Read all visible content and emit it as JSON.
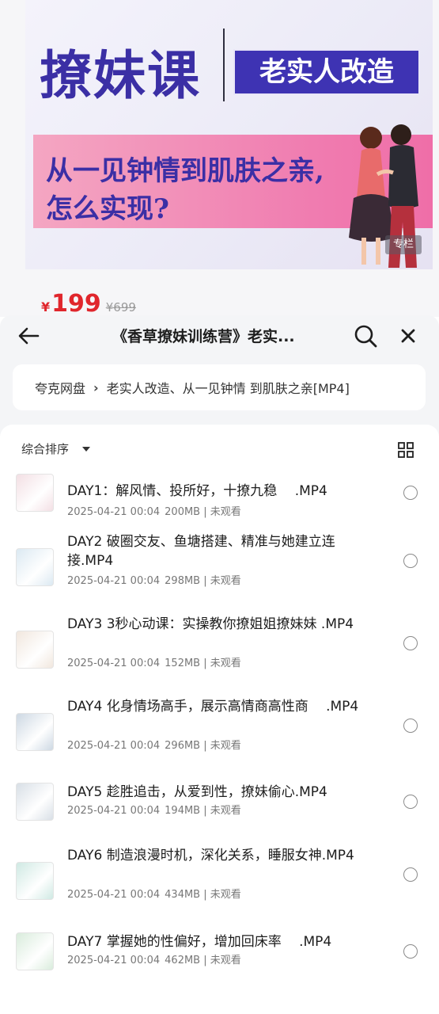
{
  "promo": {
    "title": "撩妹课",
    "tag": "老实人改造",
    "subtitle_line1": "从一见钟情到肌肤之亲,",
    "subtitle_line2": "怎么实现?",
    "badge": "专栏",
    "price_symbol": "¥",
    "price_now": "199",
    "price_old": "¥699",
    "colors": {
      "brand_purple": "#3e33b3",
      "pink": "#f07cb0",
      "price_red": "#e0262c"
    }
  },
  "nav": {
    "title": "《香草撩妹训练营》老实...",
    "back_icon": "back-arrow-icon",
    "search_icon": "search-icon",
    "close_icon": "close-icon"
  },
  "breadcrumb": {
    "root": "夸克网盘",
    "separator": "›",
    "current": "老实人改造、从一见钟情 到肌肤之亲[MP4]"
  },
  "sort": {
    "label": "综合排序",
    "view_icon": "grid-view-icon"
  },
  "files": [
    {
      "name": "DAY1：解风情、投所好，十撩九稳　 .MP4",
      "date": "2025-04-21 00:04",
      "size": "200MB",
      "status": "未观看",
      "thumb_color": "#f3dfe4"
    },
    {
      "name": "DAY2 破圈交友、鱼塘搭建、精准与她建立连接.MP4",
      "date": "2025-04-21 00:04",
      "size": "298MB",
      "status": "未观看",
      "thumb_color": "#dbe9f2"
    },
    {
      "name": "DAY3 3秒心动课：实操教你撩姐姐撩妹妹 .MP4",
      "date": "2025-04-21 00:04",
      "size": "152MB",
      "status": "未观看",
      "thumb_color": "#f1e7de"
    },
    {
      "name": "DAY4 化身情场高手，展示高情商高性商　 .MP4",
      "date": "2025-04-21 00:04",
      "size": "296MB",
      "status": "未观看",
      "thumb_color": "#cdd8e3"
    },
    {
      "name": "DAY5 趁胜追击，从爱到性，撩妹偷心.MP4",
      "date": "2025-04-21 00:04",
      "size": "194MB",
      "status": "未观看",
      "thumb_color": "#d8dfe6"
    },
    {
      "name": "DAY6 制造浪漫时机，深化关系，睡服女神.MP4",
      "date": "2025-04-21 00:04",
      "size": "434MB",
      "status": "未观看",
      "thumb_color": "#cfe9e3"
    },
    {
      "name": "DAY7 掌握她的性偏好，增加回床率　 .MP4",
      "date": "2025-04-21 00:04",
      "size": "462MB",
      "status": "未观看",
      "thumb_color": "#d9ecdc"
    }
  ]
}
